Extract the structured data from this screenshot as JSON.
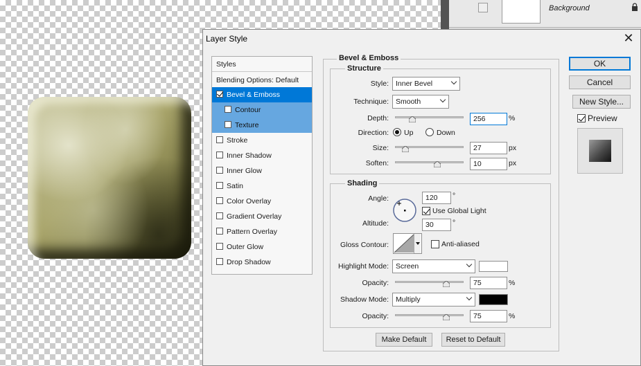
{
  "layers": {
    "layer_name": "Background"
  },
  "dialog": {
    "title": "Layer Style",
    "styles_header": "Styles",
    "blending_options": "Blending Options: Default",
    "style_items": [
      {
        "label": "Bevel & Emboss",
        "checked": true
      },
      {
        "label": "Contour",
        "checked": false
      },
      {
        "label": "Texture",
        "checked": false
      },
      {
        "label": "Stroke",
        "checked": false
      },
      {
        "label": "Inner Shadow",
        "checked": false
      },
      {
        "label": "Inner Glow",
        "checked": false
      },
      {
        "label": "Satin",
        "checked": false
      },
      {
        "label": "Color Overlay",
        "checked": false
      },
      {
        "label": "Gradient Overlay",
        "checked": false
      },
      {
        "label": "Pattern Overlay",
        "checked": false
      },
      {
        "label": "Outer Glow",
        "checked": false
      },
      {
        "label": "Drop Shadow",
        "checked": false
      }
    ],
    "section_title": "Bevel & Emboss",
    "structure": {
      "title": "Structure",
      "style_label": "Style:",
      "style_value": "Inner Bevel",
      "technique_label": "Technique:",
      "technique_value": "Smooth",
      "depth_label": "Depth:",
      "depth_value": "256",
      "depth_unit": "%",
      "depth_fraction": 0.25,
      "direction_label": "Direction:",
      "direction_up": "Up",
      "direction_down": "Down",
      "direction_selected": "Up",
      "size_label": "Size:",
      "size_value": "27",
      "size_unit": "px",
      "size_fraction": 0.15,
      "soften_label": "Soften:",
      "soften_value": "10",
      "soften_unit": "px",
      "soften_fraction": 0.62
    },
    "shading": {
      "title": "Shading",
      "angle_label": "Angle:",
      "angle_value": "120",
      "angle_unit": "°",
      "use_global_light": "Use Global Light",
      "use_global_light_checked": true,
      "altitude_label": "Altitude:",
      "altitude_value": "30",
      "altitude_unit": "°",
      "gloss_contour_label": "Gloss Contour:",
      "anti_aliased": "Anti-aliased",
      "anti_aliased_checked": false,
      "highlight_mode_label": "Highlight Mode:",
      "highlight_mode_value": "Screen",
      "highlight_color": "#ffffff",
      "highlight_opacity_label": "Opacity:",
      "highlight_opacity_value": "75",
      "highlight_opacity_unit": "%",
      "highlight_opacity_fraction": 0.75,
      "shadow_mode_label": "Shadow Mode:",
      "shadow_mode_value": "Multiply",
      "shadow_color": "#000000",
      "shadow_opacity_label": "Opacity:",
      "shadow_opacity_value": "75",
      "shadow_opacity_unit": "%",
      "shadow_opacity_fraction": 0.75
    },
    "make_default": "Make Default",
    "reset_to_default": "Reset to Default",
    "ok_label": "OK",
    "cancel_label": "Cancel",
    "new_style_label": "New Style...",
    "preview_label": "Preview",
    "preview_checked": true
  }
}
